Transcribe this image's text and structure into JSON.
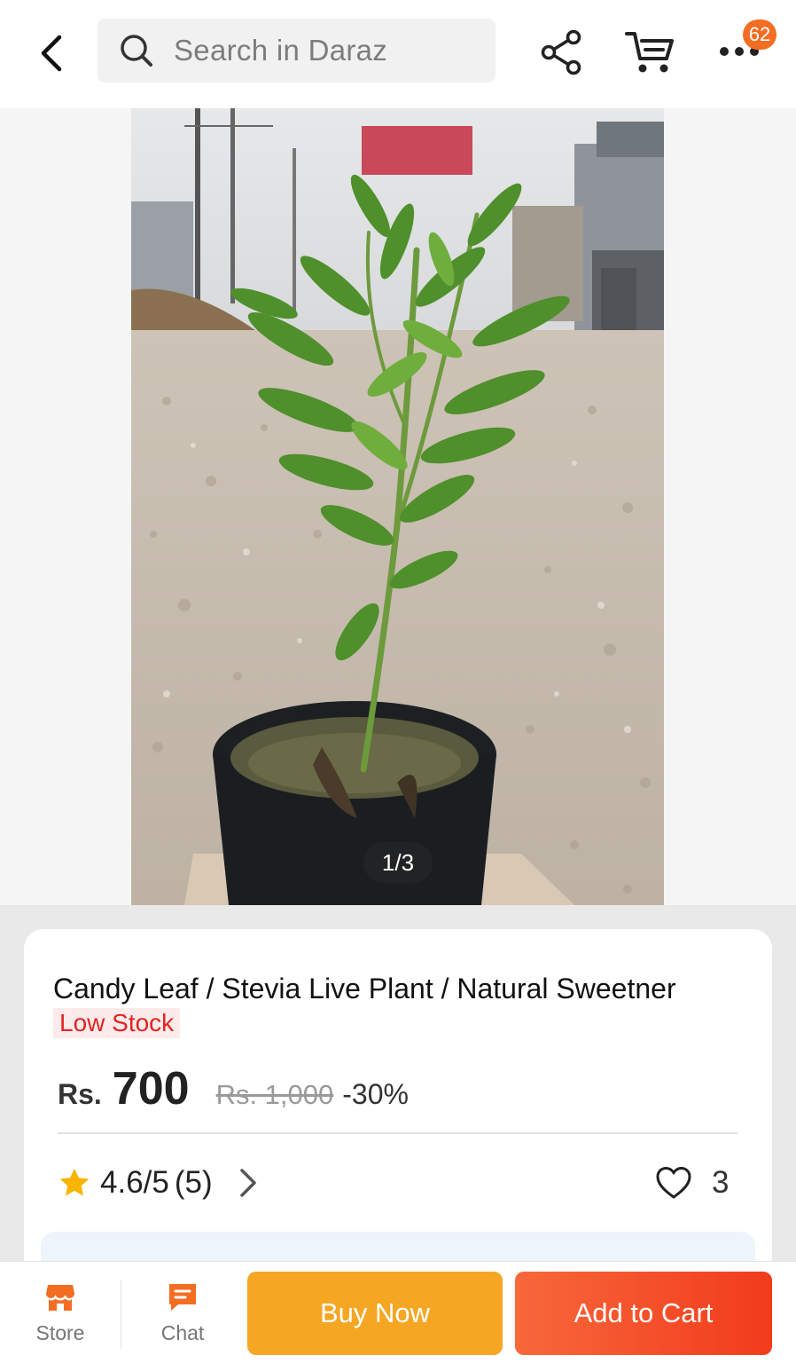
{
  "header": {
    "search_placeholder": "Search in Daraz",
    "cart_badge": "62",
    "icons": [
      "back-arrow-icon",
      "search-icon",
      "share-icon",
      "cart-icon",
      "more-icon"
    ]
  },
  "gallery": {
    "pager": "1/3",
    "image_subject": "potted plant"
  },
  "product": {
    "title": "Candy Leaf / Stevia Live Plant / Natural Sweetner",
    "stock_label": "Low Stock",
    "currency": "Rs.",
    "price": "700",
    "original_price": "Rs. 1,000",
    "discount": "-30%",
    "rating": "4.6/5",
    "rating_count": "(5)",
    "wishlist_count": "3"
  },
  "bottom_bar": {
    "store_label": "Store",
    "chat_label": "Chat",
    "buy_now_label": "Buy Now",
    "add_to_cart_label": "Add to Cart"
  },
  "colors": {
    "accent_orange": "#f36d22",
    "buy_now": "#f5a623",
    "add_to_cart": "#f23b1c",
    "low_stock": "#e02424",
    "star": "#f7b500"
  }
}
